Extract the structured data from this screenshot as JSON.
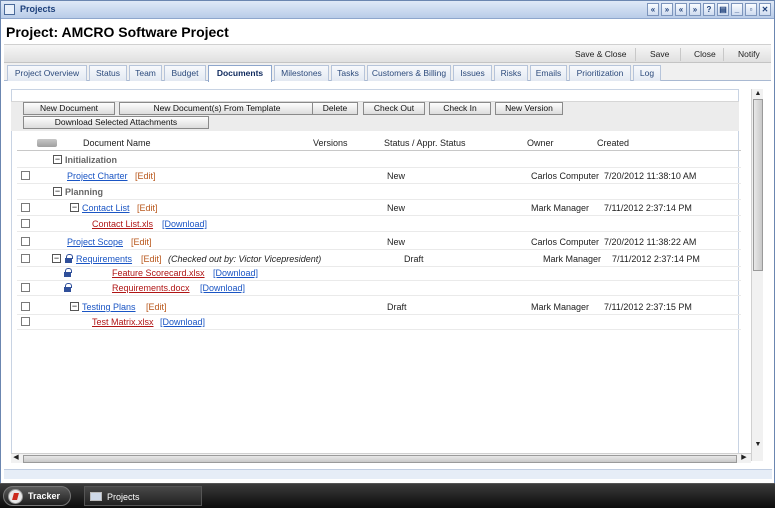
{
  "window": {
    "title": "Projects",
    "buttons": [
      "«",
      "»",
      "«",
      "»",
      "?",
      "▤",
      "_",
      "▫",
      "✕"
    ]
  },
  "project_title": "Project: AMCRO Software Project",
  "actions": [
    "Save & Close",
    "Save",
    "Close",
    "Notify"
  ],
  "tabs": [
    "Project Overview",
    "Status",
    "Team",
    "Budget",
    "Documents",
    "Milestones",
    "Tasks",
    "Customers & Billing",
    "Issues",
    "Risks",
    "Emails",
    "Prioritization",
    "Log"
  ],
  "active_tab": "Documents",
  "toolbar": {
    "new_document": "New Document",
    "new_from_template": "New Document(s) From Template",
    "delete": "Delete",
    "check_out": "Check Out",
    "check_in": "Check In",
    "new_version": "New Version",
    "download_selected": "Download Selected Attachments"
  },
  "columns": {
    "name": "Document Name",
    "versions": "Versions",
    "status": "Status / Appr. Status",
    "owner": "Owner",
    "created": "Created"
  },
  "groups": {
    "initialization": "Initialization",
    "planning": "Planning"
  },
  "documents": {
    "charter": {
      "name": "Project Charter",
      "edit": "[Edit]",
      "status": "New",
      "owner": "Carlos Computer",
      "created": "7/20/2012 11:38:10 AM"
    },
    "contact": {
      "name": "Contact List",
      "edit": "[Edit]",
      "status": "New",
      "owner": "Mark Manager",
      "created": "7/11/2012 2:37:14 PM"
    },
    "contact_file": {
      "name": "Contact List.xls",
      "download": "[Download]"
    },
    "scope": {
      "name": "Project Scope",
      "edit": "[Edit]",
      "status": "New",
      "owner": "Carlos Computer",
      "created": "7/20/2012 11:38:22 AM"
    },
    "requirements": {
      "name": "Requirements",
      "edit": "[Edit]",
      "checked_out": "(Checked out by: Victor Vicepresident)",
      "status": "Draft",
      "owner": "Mark Manager",
      "created": "7/11/2012 2:37:14 PM"
    },
    "scorecard_file": {
      "name": "Feature Scorecard.xlsx",
      "download": "[Download]"
    },
    "requirements_file": {
      "name": "Requirements.docx",
      "download": "[Download]"
    },
    "testing": {
      "name": "Testing Plans",
      "edit": "[Edit]",
      "status": "Draft",
      "owner": "Mark Manager",
      "created": "7/11/2012 2:37:15 PM"
    },
    "testmatrix_file": {
      "name": "Test Matrix.xlsx",
      "download": "[Download]"
    }
  },
  "taskbar": {
    "start": "Tracker",
    "item": "Projects"
  }
}
